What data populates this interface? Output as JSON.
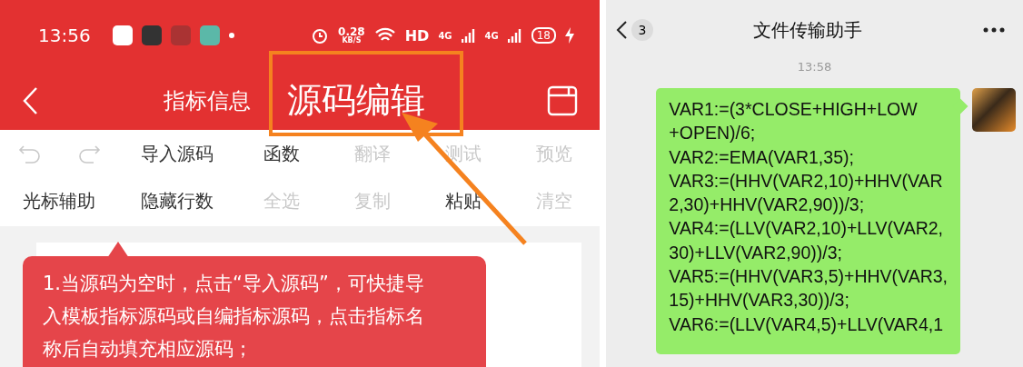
{
  "left_phone": {
    "status_bar": {
      "time": "13:56",
      "speed_value": "0.28",
      "speed_unit": "KB/S",
      "hd": "HD",
      "networks": [
        "4G",
        "4G"
      ],
      "battery": "18"
    },
    "nav": {
      "tabs": [
        {
          "label": "指标信息",
          "selected": false
        },
        {
          "label": "源码编辑",
          "selected": true
        }
      ]
    },
    "toolbar": {
      "rows": [
        [
          {
            "kind": "history",
            "buttons": [
              {
                "kind": "undo",
                "disabled": true
              },
              {
                "kind": "redo",
                "disabled": true
              }
            ]
          },
          {
            "kind": "text",
            "label": "导入源码",
            "disabled": false
          },
          {
            "kind": "text",
            "label": "函数",
            "disabled": false
          },
          {
            "kind": "text",
            "label": "翻译",
            "disabled": true
          },
          {
            "kind": "text",
            "label": "测试",
            "disabled": true
          },
          {
            "kind": "text",
            "label": "预览",
            "disabled": true
          }
        ],
        [
          {
            "kind": "text",
            "label": "光标辅助",
            "disabled": false
          },
          {
            "kind": "text",
            "label": "隐藏行数",
            "disabled": false
          },
          {
            "kind": "text",
            "label": "全选",
            "disabled": true
          },
          {
            "kind": "text",
            "label": "复制",
            "disabled": true
          },
          {
            "kind": "text",
            "label": "粘贴",
            "disabled": false
          },
          {
            "kind": "text",
            "label": "清空",
            "disabled": true
          }
        ]
      ]
    },
    "tooltip": {
      "text": "1.当源码为空时，点击“导入源码”，可快捷导入模板指标源码或自编指标源码，点击指标名称后自动填充相应源码；"
    }
  },
  "right_phone": {
    "header": {
      "unread": "3",
      "title": "文件传输助手"
    },
    "timestamp": "13:58",
    "message": {
      "text": "VAR1:=(3*CLOSE+HIGH+LOW\n+OPEN)/6;\nVAR2:=EMA(VAR1,35);\nVAR3:=(HHV(VAR2,10)+HHV(VAR\n2,30)+HHV(VAR2,90))/3;\nVAR4:=(LLV(VAR2,10)+LLV(VAR2,\n30)+LLV(VAR2,90))/3;\nVAR5:=(HHV(VAR3,5)+HHV(VAR3,\n15)+HHV(VAR3,30))/3;\nVAR6:=(LLV(VAR4,5)+LLV(VAR4,1"
    }
  }
}
